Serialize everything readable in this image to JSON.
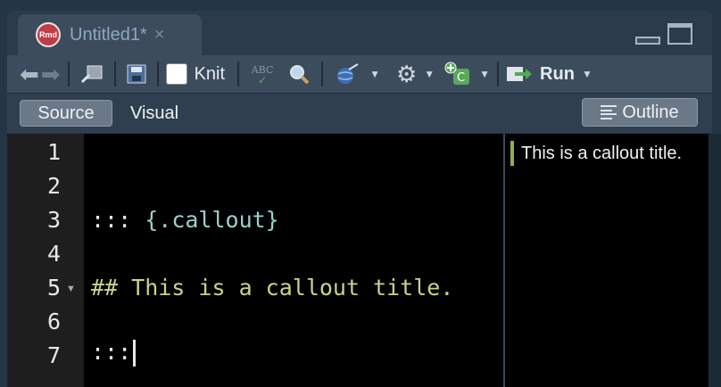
{
  "tab": {
    "icon_text": "Rmd",
    "title": "Untitled1*",
    "close": "×"
  },
  "toolbar": {
    "knit_label": "Knit",
    "run_label": "Run",
    "spell_label": "ABC"
  },
  "modebar": {
    "source_label": "Source",
    "visual_label": "Visual",
    "outline_label": "Outline"
  },
  "editor": {
    "line_numbers": [
      "1",
      "2",
      "3",
      "4",
      "5",
      "6",
      "7"
    ],
    "line3_a": "::: ",
    "line3_b": "{.callout}",
    "line5": "## This is a callout title.",
    "line7": ":::"
  },
  "outline": {
    "item": "This is a callout title."
  }
}
